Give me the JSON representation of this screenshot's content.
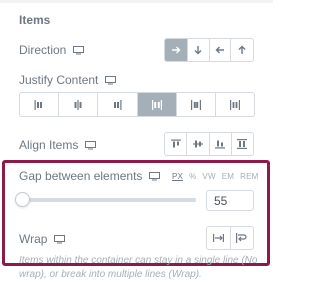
{
  "section": {
    "title": "Items"
  },
  "direction": {
    "label": "Direction",
    "device_icon": "monitor-icon",
    "options": [
      {
        "icon": "arrow-right-icon",
        "active": true
      },
      {
        "icon": "arrow-down-icon",
        "active": false
      },
      {
        "icon": "arrow-left-icon",
        "active": false
      },
      {
        "icon": "arrow-up-icon",
        "active": false
      }
    ]
  },
  "justify_content": {
    "label": "Justify Content",
    "device_icon": "monitor-icon",
    "options": [
      {
        "icon": "justify-start-icon",
        "active": false
      },
      {
        "icon": "justify-center-icon",
        "active": false
      },
      {
        "icon": "justify-end-icon",
        "active": false
      },
      {
        "icon": "justify-space-between-icon",
        "active": true
      },
      {
        "icon": "justify-space-around-icon",
        "active": false
      },
      {
        "icon": "justify-space-evenly-icon",
        "active": false
      }
    ]
  },
  "align_items": {
    "label": "Align Items",
    "device_icon": "monitor-icon",
    "options": [
      {
        "icon": "align-start-icon",
        "active": false
      },
      {
        "icon": "align-center-icon",
        "active": false
      },
      {
        "icon": "align-end-icon",
        "active": false
      },
      {
        "icon": "align-stretch-icon",
        "active": false
      }
    ]
  },
  "gap": {
    "label": "Gap between elements",
    "device_icon": "monitor-icon",
    "units": [
      "PX",
      "%",
      "VW",
      "EM",
      "REM"
    ],
    "selected_unit": "PX",
    "value": "55",
    "slider_level": 0.0
  },
  "wrap": {
    "label": "Wrap",
    "device_icon": "monitor-icon",
    "options": [
      {
        "icon": "no-wrap-icon",
        "active": false
      },
      {
        "icon": "wrap-icon",
        "active": false
      }
    ],
    "help": "Items within the container can stay in a single line (No wrap), or break into multiple lines (Wrap)."
  },
  "colors": {
    "highlight_border": "#8e1a4b",
    "active_button": "#a4afb7",
    "text": "#6d7882"
  }
}
